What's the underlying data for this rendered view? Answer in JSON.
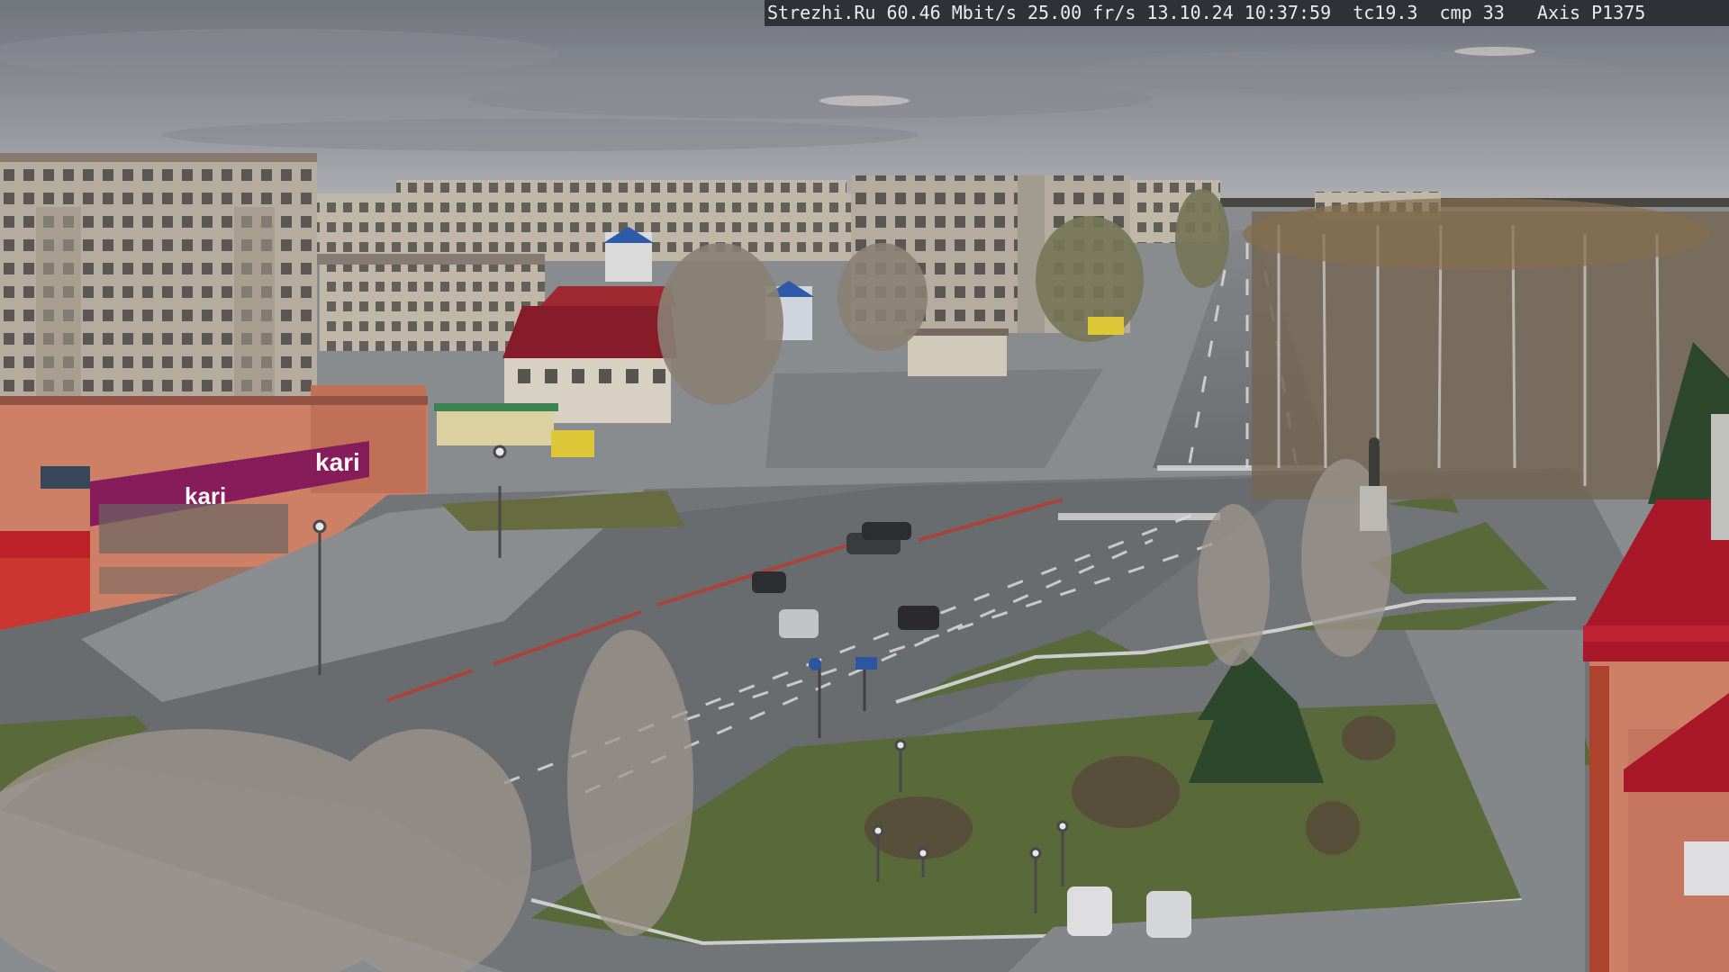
{
  "overlay": {
    "osd_text": "Strezhi.Ru 60.46 Mbit/s 25.00 fr/s 13.10.24 10:37:59  tc19.3  cmp 33   Axis P1375"
  },
  "storefront": {
    "brand": "kari",
    "sign_text": "kari"
  },
  "colors": {
    "sky_top": "#7c8088",
    "sky_bottom": "#b3b6ba",
    "asphalt": "#777a7d",
    "lawn": "#5d6e3c",
    "kari_magenta": "#8c1e5e",
    "roof_red": "#b01a2a",
    "facade_orange": "#d6866a"
  }
}
